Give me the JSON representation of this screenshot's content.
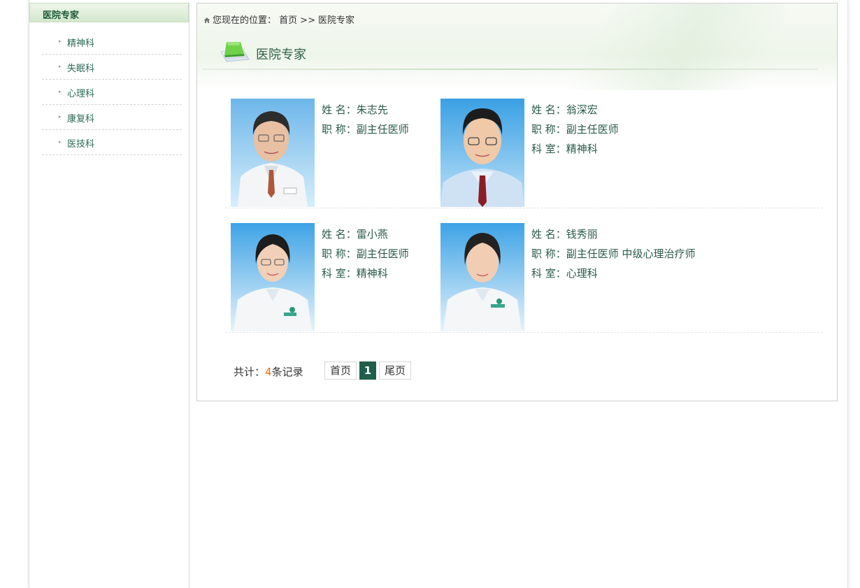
{
  "sidebar": {
    "title": "医院专家",
    "items": [
      {
        "label": "精神科"
      },
      {
        "label": "失眠科"
      },
      {
        "label": "心理科"
      },
      {
        "label": "康复科"
      },
      {
        "label": "医技科"
      }
    ]
  },
  "breadcrumb": {
    "prefix": "您现在的位置：",
    "home": "首页",
    "separator": ">>",
    "current": "医院专家"
  },
  "section": {
    "title": "医院专家"
  },
  "doctors": [
    {
      "name_label": "姓 名：",
      "name": "朱志先",
      "title_label": "职 称：",
      "title": "副主任医师"
    },
    {
      "name_label": "姓 名：",
      "name": "翁深宏",
      "title_label": "职 称：",
      "title": "副主任医师",
      "dept_label": "科 室：",
      "dept": "精神科"
    },
    {
      "name_label": "姓 名：",
      "name": "雷小燕",
      "title_label": "职 称：",
      "title": "副主任医师",
      "dept_label": "科 室：",
      "dept": "精神科"
    },
    {
      "name_label": "姓 名：",
      "name": "钱秀丽",
      "title_label": "职 称：",
      "title": "副主任医师 中级心理治疗师",
      "dept_label": "科 室：",
      "dept": "心理科"
    }
  ],
  "pagination": {
    "total_prefix": "共计：",
    "total_count": "4",
    "total_suffix": "条记录",
    "first": "首页",
    "current": "1",
    "last": "尾页"
  },
  "colors": {
    "accent": "#1e5e4a",
    "highlight": "#ff6600",
    "link": "#2d6b58"
  }
}
